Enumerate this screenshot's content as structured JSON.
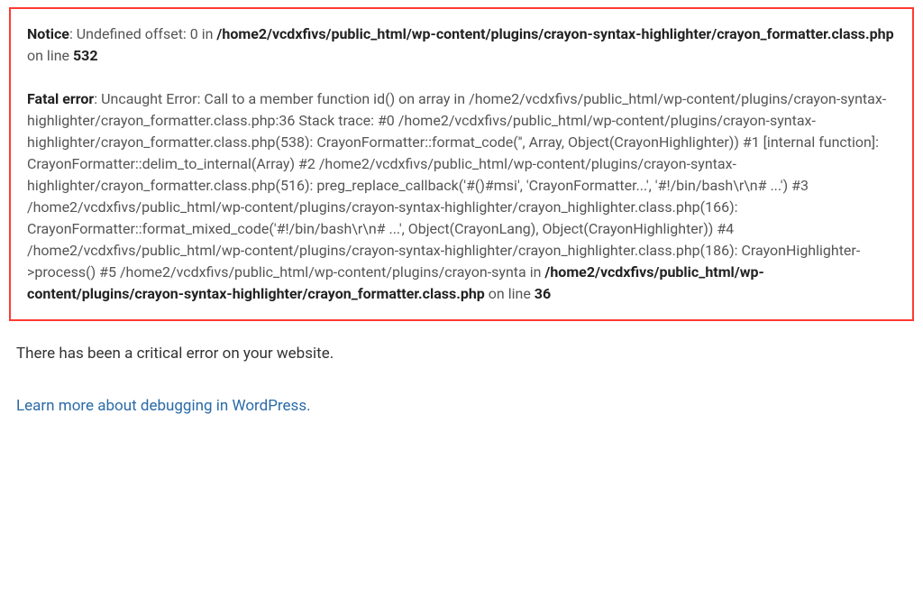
{
  "errorBox": {
    "notice": {
      "label": "Notice",
      "message": ": Undefined offset: 0 in ",
      "path": "/home2/vcdxfivs/public_html/wp-content/plugins/crayon-syntax-highlighter/crayon_formatter.class.php",
      "onLine": " on line ",
      "line": "532"
    },
    "fatal": {
      "label": "Fatal error",
      "message": ": Uncaught Error: Call to a member function id() on array in /home2/vcdxfivs/public_html/wp-content/plugins/crayon-syntax-highlighter/crayon_formatter.class.php:36 Stack trace: #0 /home2/vcdxfivs/public_html/wp-content/plugins/crayon-syntax-highlighter/crayon_formatter.class.php(538): CrayonFormatter::format_code('', Array, Object(CrayonHighlighter)) #1 [internal function]: CrayonFormatter::delim_to_internal(Array) #2 /home2/vcdxfivs/public_html/wp-content/plugins/crayon-syntax-highlighter/crayon_formatter.class.php(516): preg_replace_callback('#()#msi', 'CrayonFormatter...', '#!/bin/bash\\r\\n# ...') #3 /home2/vcdxfivs/public_html/wp-content/plugins/crayon-syntax-highlighter/crayon_highlighter.class.php(166): CrayonFormatter::format_mixed_code('#!/bin/bash\\r\\n# ...', Object(CrayonLang), Object(CrayonHighlighter)) #4 /home2/vcdxfivs/public_html/wp-content/plugins/crayon-syntax-highlighter/crayon_highlighter.class.php(186): CrayonHighlighter->process() #5 /home2/vcdxfivs/public_html/wp-content/plugins/crayon-synta in ",
      "path": "/home2/vcdxfivs/public_html/wp-content/plugins/crayon-syntax-highlighter/crayon_formatter.class.php",
      "onLine": " on line ",
      "line": "36"
    }
  },
  "criticalMessage": "There has been a critical error on your website.",
  "debugLink": "Learn more about debugging in WordPress."
}
